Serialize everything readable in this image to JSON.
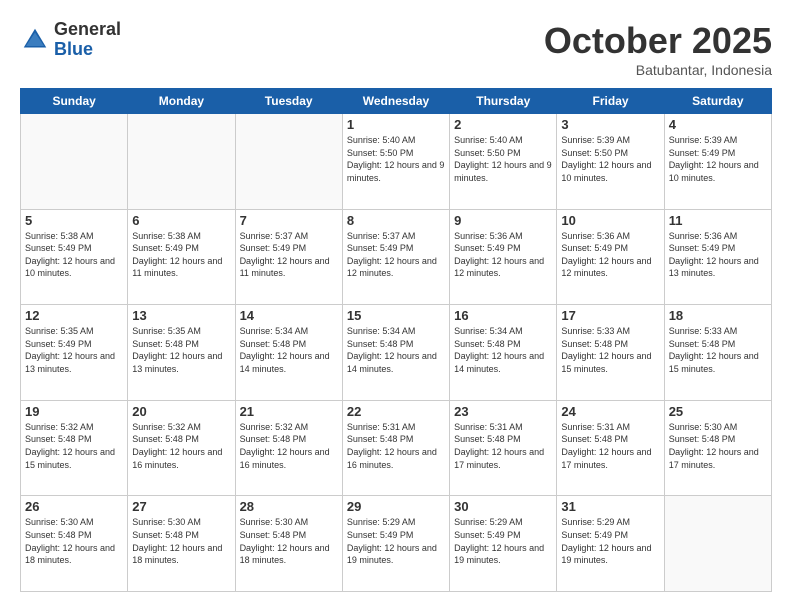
{
  "logo": {
    "general": "General",
    "blue": "Blue"
  },
  "header": {
    "month": "October 2025",
    "location": "Batubantar, Indonesia"
  },
  "weekdays": [
    "Sunday",
    "Monday",
    "Tuesday",
    "Wednesday",
    "Thursday",
    "Friday",
    "Saturday"
  ],
  "weeks": [
    [
      {
        "day": "",
        "info": ""
      },
      {
        "day": "",
        "info": ""
      },
      {
        "day": "",
        "info": ""
      },
      {
        "day": "1",
        "info": "Sunrise: 5:40 AM\nSunset: 5:50 PM\nDaylight: 12 hours\nand 9 minutes."
      },
      {
        "day": "2",
        "info": "Sunrise: 5:40 AM\nSunset: 5:50 PM\nDaylight: 12 hours\nand 9 minutes."
      },
      {
        "day": "3",
        "info": "Sunrise: 5:39 AM\nSunset: 5:50 PM\nDaylight: 12 hours\nand 10 minutes."
      },
      {
        "day": "4",
        "info": "Sunrise: 5:39 AM\nSunset: 5:49 PM\nDaylight: 12 hours\nand 10 minutes."
      }
    ],
    [
      {
        "day": "5",
        "info": "Sunrise: 5:38 AM\nSunset: 5:49 PM\nDaylight: 12 hours\nand 10 minutes."
      },
      {
        "day": "6",
        "info": "Sunrise: 5:38 AM\nSunset: 5:49 PM\nDaylight: 12 hours\nand 11 minutes."
      },
      {
        "day": "7",
        "info": "Sunrise: 5:37 AM\nSunset: 5:49 PM\nDaylight: 12 hours\nand 11 minutes."
      },
      {
        "day": "8",
        "info": "Sunrise: 5:37 AM\nSunset: 5:49 PM\nDaylight: 12 hours\nand 12 minutes."
      },
      {
        "day": "9",
        "info": "Sunrise: 5:36 AM\nSunset: 5:49 PM\nDaylight: 12 hours\nand 12 minutes."
      },
      {
        "day": "10",
        "info": "Sunrise: 5:36 AM\nSunset: 5:49 PM\nDaylight: 12 hours\nand 12 minutes."
      },
      {
        "day": "11",
        "info": "Sunrise: 5:36 AM\nSunset: 5:49 PM\nDaylight: 12 hours\nand 13 minutes."
      }
    ],
    [
      {
        "day": "12",
        "info": "Sunrise: 5:35 AM\nSunset: 5:49 PM\nDaylight: 12 hours\nand 13 minutes."
      },
      {
        "day": "13",
        "info": "Sunrise: 5:35 AM\nSunset: 5:48 PM\nDaylight: 12 hours\nand 13 minutes."
      },
      {
        "day": "14",
        "info": "Sunrise: 5:34 AM\nSunset: 5:48 PM\nDaylight: 12 hours\nand 14 minutes."
      },
      {
        "day": "15",
        "info": "Sunrise: 5:34 AM\nSunset: 5:48 PM\nDaylight: 12 hours\nand 14 minutes."
      },
      {
        "day": "16",
        "info": "Sunrise: 5:34 AM\nSunset: 5:48 PM\nDaylight: 12 hours\nand 14 minutes."
      },
      {
        "day": "17",
        "info": "Sunrise: 5:33 AM\nSunset: 5:48 PM\nDaylight: 12 hours\nand 15 minutes."
      },
      {
        "day": "18",
        "info": "Sunrise: 5:33 AM\nSunset: 5:48 PM\nDaylight: 12 hours\nand 15 minutes."
      }
    ],
    [
      {
        "day": "19",
        "info": "Sunrise: 5:32 AM\nSunset: 5:48 PM\nDaylight: 12 hours\nand 15 minutes."
      },
      {
        "day": "20",
        "info": "Sunrise: 5:32 AM\nSunset: 5:48 PM\nDaylight: 12 hours\nand 16 minutes."
      },
      {
        "day": "21",
        "info": "Sunrise: 5:32 AM\nSunset: 5:48 PM\nDaylight: 12 hours\nand 16 minutes."
      },
      {
        "day": "22",
        "info": "Sunrise: 5:31 AM\nSunset: 5:48 PM\nDaylight: 12 hours\nand 16 minutes."
      },
      {
        "day": "23",
        "info": "Sunrise: 5:31 AM\nSunset: 5:48 PM\nDaylight: 12 hours\nand 17 minutes."
      },
      {
        "day": "24",
        "info": "Sunrise: 5:31 AM\nSunset: 5:48 PM\nDaylight: 12 hours\nand 17 minutes."
      },
      {
        "day": "25",
        "info": "Sunrise: 5:30 AM\nSunset: 5:48 PM\nDaylight: 12 hours\nand 17 minutes."
      }
    ],
    [
      {
        "day": "26",
        "info": "Sunrise: 5:30 AM\nSunset: 5:48 PM\nDaylight: 12 hours\nand 18 minutes."
      },
      {
        "day": "27",
        "info": "Sunrise: 5:30 AM\nSunset: 5:48 PM\nDaylight: 12 hours\nand 18 minutes."
      },
      {
        "day": "28",
        "info": "Sunrise: 5:30 AM\nSunset: 5:48 PM\nDaylight: 12 hours\nand 18 minutes."
      },
      {
        "day": "29",
        "info": "Sunrise: 5:29 AM\nSunset: 5:49 PM\nDaylight: 12 hours\nand 19 minutes."
      },
      {
        "day": "30",
        "info": "Sunrise: 5:29 AM\nSunset: 5:49 PM\nDaylight: 12 hours\nand 19 minutes."
      },
      {
        "day": "31",
        "info": "Sunrise: 5:29 AM\nSunset: 5:49 PM\nDaylight: 12 hours\nand 19 minutes."
      },
      {
        "day": "",
        "info": ""
      }
    ]
  ]
}
